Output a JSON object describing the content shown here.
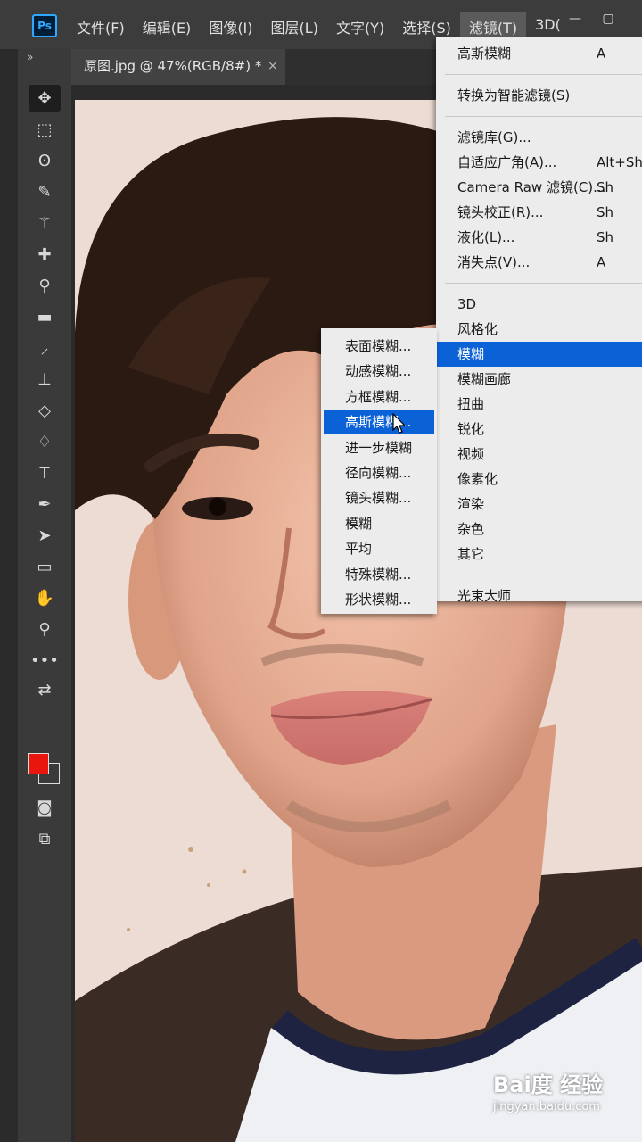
{
  "app": {
    "logo_text": "Ps"
  },
  "menubar": {
    "items": [
      {
        "label": "文件(F)"
      },
      {
        "label": "编辑(E)"
      },
      {
        "label": "图像(I)"
      },
      {
        "label": "图层(L)"
      },
      {
        "label": "文字(Y)"
      },
      {
        "label": "选择(S)"
      },
      {
        "label": "滤镜(T)"
      },
      {
        "label": "3D("
      }
    ],
    "active_index": 6,
    "minimize_icon": "minimize-icon",
    "restore_icon": "restore-icon"
  },
  "tabs": {
    "collapse_label": "»",
    "document_title": "原图.jpg @ 47%(RGB/8#) *",
    "close_label": "×"
  },
  "toolbar": {
    "tools": [
      {
        "name": "move-tool",
        "icon": "move-icon",
        "glyph": "✥"
      },
      {
        "name": "marquee-tool",
        "icon": "marquee-icon",
        "glyph": "⬚"
      },
      {
        "name": "lasso-tool",
        "icon": "lasso-icon",
        "glyph": "ʘ"
      },
      {
        "name": "quick-select-tool",
        "icon": "quick-select-icon",
        "glyph": "✎"
      },
      {
        "name": "magic-wand-tool",
        "icon": "magic-wand-icon",
        "glyph": "⚚"
      },
      {
        "name": "healing-brush-tool",
        "icon": "bandage-icon",
        "glyph": "✚"
      },
      {
        "name": "eyedropper-tool",
        "icon": "eyedropper-icon",
        "glyph": "⚲"
      },
      {
        "name": "gradient-tool",
        "icon": "gradient-icon",
        "glyph": "▬"
      },
      {
        "name": "brush-tool",
        "icon": "brush-icon",
        "glyph": "⸝"
      },
      {
        "name": "stamp-tool",
        "icon": "stamp-icon",
        "glyph": "⊥"
      },
      {
        "name": "eraser-tool",
        "icon": "eraser-icon",
        "glyph": "◇"
      },
      {
        "name": "paint-bucket-tool",
        "icon": "paint-bucket-icon",
        "glyph": "♢"
      },
      {
        "name": "type-tool",
        "icon": "type-icon",
        "glyph": "T"
      },
      {
        "name": "pen-tool",
        "icon": "pen-icon",
        "glyph": "✒"
      },
      {
        "name": "path-select-tool",
        "icon": "arrow-pointer-icon",
        "glyph": "➤"
      },
      {
        "name": "rectangle-tool",
        "icon": "rectangle-icon",
        "glyph": "▭"
      },
      {
        "name": "hand-tool",
        "icon": "hand-icon",
        "glyph": "✋"
      },
      {
        "name": "zoom-tool",
        "icon": "zoom-icon",
        "glyph": "⚲"
      },
      {
        "name": "more-tools",
        "icon": "ellipsis-icon",
        "glyph": "•••"
      },
      {
        "name": "default-colors",
        "icon": "swap-colors-icon",
        "glyph": "⇄"
      }
    ],
    "foreground_color": "#e8160c",
    "background_color": "#3a3a3a",
    "quick_mask_icon": "quick-mask-icon",
    "screen_mode_icon": "screen-mode-icon"
  },
  "filter_menu": {
    "items": [
      {
        "label": "高斯模糊",
        "shortcut": "A",
        "sep_after": true
      },
      {
        "label": "转换为智能滤镜(S)",
        "shortcut": "",
        "sep_after": true
      },
      {
        "label": "滤镜库(G)...",
        "shortcut": ""
      },
      {
        "label": "自适应广角(A)...",
        "shortcut": "Alt+Sh"
      },
      {
        "label": "Camera Raw 滤镜(C)...",
        "shortcut": "Sh"
      },
      {
        "label": "镜头校正(R)...",
        "shortcut": "Sh"
      },
      {
        "label": "液化(L)...",
        "shortcut": "Sh"
      },
      {
        "label": "消失点(V)...",
        "shortcut": "A",
        "sep_after": true
      },
      {
        "label": "3D",
        "shortcut": ""
      },
      {
        "label": "风格化",
        "shortcut": ""
      },
      {
        "label": "模糊",
        "shortcut": "",
        "highlighted": true
      },
      {
        "label": "模糊画廊",
        "shortcut": ""
      },
      {
        "label": "扭曲",
        "shortcut": ""
      },
      {
        "label": "锐化",
        "shortcut": ""
      },
      {
        "label": "视频",
        "shortcut": ""
      },
      {
        "label": "像素化",
        "shortcut": ""
      },
      {
        "label": "渲染",
        "shortcut": ""
      },
      {
        "label": "杂色",
        "shortcut": ""
      },
      {
        "label": "其它",
        "shortcut": "",
        "sep_after": true
      },
      {
        "label": "光束大师",
        "shortcut": ""
      }
    ]
  },
  "blur_submenu": {
    "items": [
      {
        "label": "表面模糊..."
      },
      {
        "label": "动感模糊..."
      },
      {
        "label": "方框模糊..."
      },
      {
        "label": "高斯模糊...",
        "highlighted": true
      },
      {
        "label": "进一步模糊"
      },
      {
        "label": "径向模糊..."
      },
      {
        "label": "镜头模糊..."
      },
      {
        "label": "模糊"
      },
      {
        "label": "平均"
      },
      {
        "label": "特殊模糊..."
      },
      {
        "label": "形状模糊..."
      }
    ]
  },
  "watermark": {
    "brand": "Bai度 经验",
    "url": "jingyan.baidu.com"
  },
  "colors": {
    "highlight": "#0b61d6",
    "menu_bg": "#ececec",
    "chrome": "#3c3c3c"
  }
}
